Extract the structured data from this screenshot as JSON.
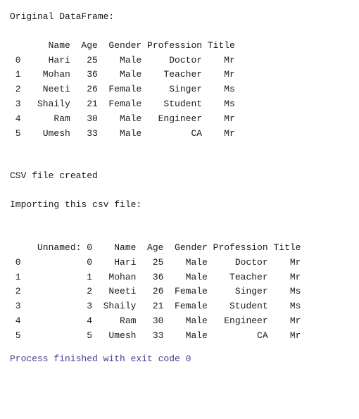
{
  "labels": {
    "original": "Original DataFrame:",
    "csv_created": "CSV file created",
    "importing": "Importing this csv file:"
  },
  "table1": {
    "columns": [
      "Name",
      "Age",
      "Gender",
      "Profession",
      "Title"
    ],
    "widths": [
      9,
      5,
      8,
      11,
      6
    ],
    "index_width": 2,
    "rows": [
      {
        "idx": "0",
        "Name": "Hari",
        "Age": "25",
        "Gender": "Male",
        "Profession": "Doctor",
        "Title": "Mr"
      },
      {
        "idx": "1",
        "Name": "Mohan",
        "Age": "36",
        "Gender": "Male",
        "Profession": "Teacher",
        "Title": "Mr"
      },
      {
        "idx": "2",
        "Name": "Neeti",
        "Age": "26",
        "Gender": "Female",
        "Profession": "Singer",
        "Title": "Ms"
      },
      {
        "idx": "3",
        "Name": "Shaily",
        "Age": "21",
        "Gender": "Female",
        "Profession": "Student",
        "Title": "Ms"
      },
      {
        "idx": "4",
        "Name": "Ram",
        "Age": "30",
        "Gender": "Male",
        "Profession": "Engineer",
        "Title": "Mr"
      },
      {
        "idx": "5",
        "Name": "Umesh",
        "Age": "33",
        "Gender": "Male",
        "Profession": "CA",
        "Title": "Mr"
      }
    ]
  },
  "table2": {
    "columns": [
      "Unnamed: 0",
      "Name",
      "Age",
      "Gender",
      "Profession",
      "Title"
    ],
    "widths": [
      13,
      8,
      5,
      8,
      11,
      6
    ],
    "index_width": 2,
    "rows": [
      {
        "idx": "0",
        "Unnamed: 0": "0",
        "Name": "Hari",
        "Age": "25",
        "Gender": "Male",
        "Profession": "Doctor",
        "Title": "Mr"
      },
      {
        "idx": "1",
        "Unnamed: 0": "1",
        "Name": "Mohan",
        "Age": "36",
        "Gender": "Male",
        "Profession": "Teacher",
        "Title": "Mr"
      },
      {
        "idx": "2",
        "Unnamed: 0": "2",
        "Name": "Neeti",
        "Age": "26",
        "Gender": "Female",
        "Profession": "Singer",
        "Title": "Ms"
      },
      {
        "idx": "3",
        "Unnamed: 0": "3",
        "Name": "Shaily",
        "Age": "21",
        "Gender": "Female",
        "Profession": "Student",
        "Title": "Ms"
      },
      {
        "idx": "4",
        "Unnamed: 0": "4",
        "Name": "Ram",
        "Age": "30",
        "Gender": "Male",
        "Profession": "Engineer",
        "Title": "Mr"
      },
      {
        "idx": "5",
        "Unnamed: 0": "5",
        "Name": "Umesh",
        "Age": "33",
        "Gender": "Male",
        "Profession": "CA",
        "Title": "Mr"
      }
    ]
  },
  "status": "Process finished with exit code 0"
}
